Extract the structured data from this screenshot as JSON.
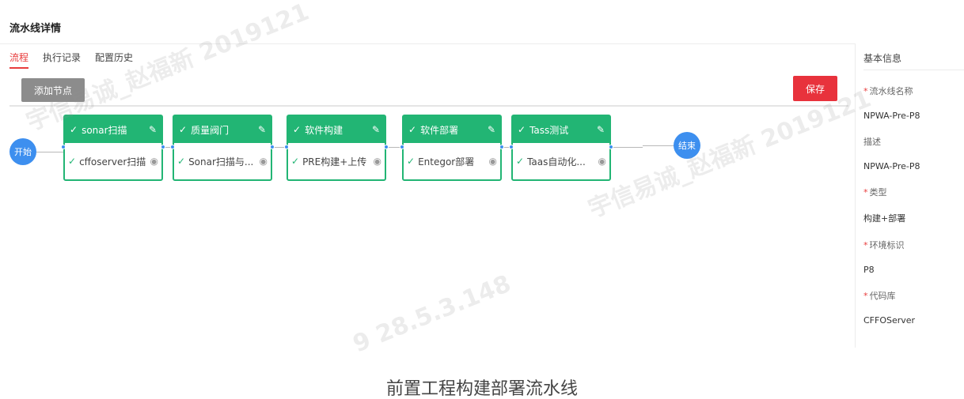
{
  "page": {
    "title": "流水线详情"
  },
  "tabs": [
    {
      "label": "流程",
      "active": true
    },
    {
      "label": "执行记录",
      "active": false
    },
    {
      "label": "配置历史",
      "active": false
    }
  ],
  "toolbar": {
    "add_node_label": "添加节点",
    "save_label": "保存"
  },
  "pipeline": {
    "start_label": "开始",
    "end_label": "结束",
    "stages": [
      {
        "name": "sonar扫描",
        "task": "cffoserver扫描"
      },
      {
        "name": "质量阀门",
        "task": "Sonar扫描与..."
      },
      {
        "name": "软件构建",
        "task": "PRE构建+上传"
      },
      {
        "name": "软件部署",
        "task": "Entegor部署"
      },
      {
        "name": "Tass测试",
        "task": "Taas自动化..."
      }
    ]
  },
  "sidebar": {
    "title": "基本信息",
    "fields": [
      {
        "label": "流水线名称",
        "required": true,
        "value": "NPWA-Pre-P8"
      },
      {
        "label": "描述",
        "required": false,
        "value": "NPWA-Pre-P8"
      },
      {
        "label": "类型",
        "required": true,
        "value": "构建+部署"
      },
      {
        "label": "环境标识",
        "required": true,
        "value": "P8"
      },
      {
        "label": "代码库",
        "required": true,
        "value": "CFFOServer"
      }
    ]
  },
  "watermark": {
    "line1": "宇信易诚_赵福新 2019121",
    "line2": "9 28.5.3.148"
  },
  "caption": "前置工程构建部署流水线",
  "colors": {
    "accent_red": "#e83c3c",
    "stage_green": "#22b574",
    "node_blue": "#3d8fef"
  },
  "icons": {
    "check": "check-icon",
    "edit": "pencil-icon",
    "view": "eye-icon"
  }
}
